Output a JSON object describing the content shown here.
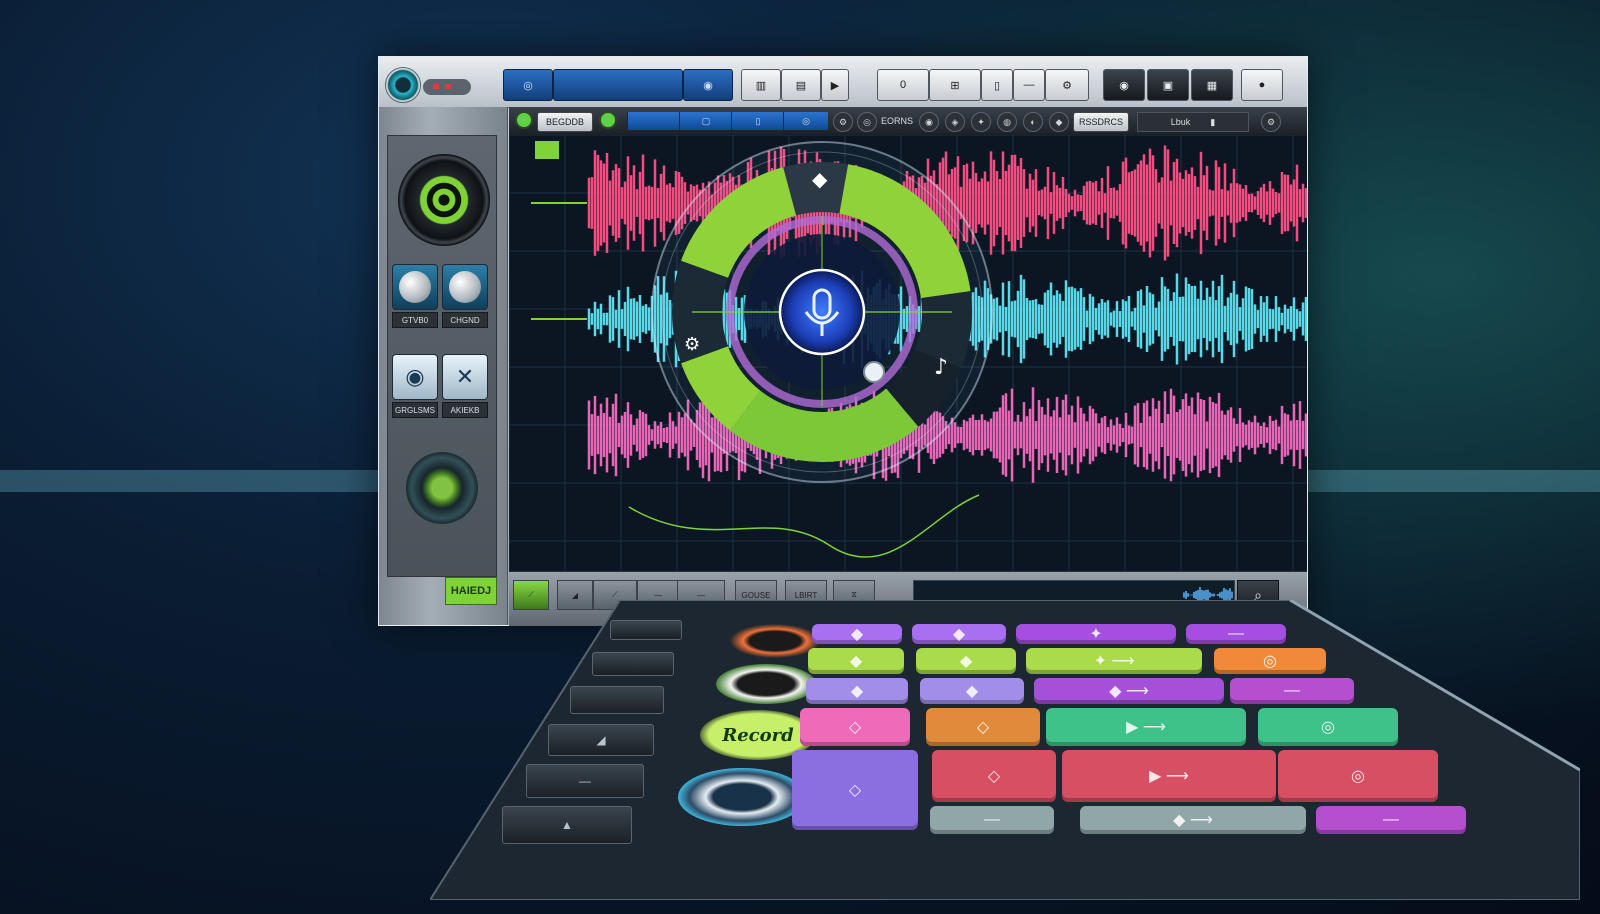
{
  "colors": {
    "accent_green": "#7fd337",
    "accent_blue": "#2a74d0",
    "wave_pink": "#ff4f86",
    "wave_cyan": "#5fe3f2",
    "wave_magenta": "#ff6fc8"
  },
  "toolbar": {
    "icons": [
      "power-icon",
      "status-leds-icon",
      "loop-icon",
      "play-icon",
      "split-icon",
      "grid-icon",
      "mic-icon",
      "settings-icon",
      "eye-icon",
      "record-icon"
    ]
  },
  "subbar": {
    "record_label": "BEGDDB",
    "mode_label": "EORNS",
    "preset_label": "RSSDRCS",
    "level_label": "Lbuk"
  },
  "left_panel": {
    "knob1_label": "GTVB0",
    "knob2_label": "CHGND",
    "button1_label": "GRGLSMS",
    "button2_label": "AKIEKB",
    "status_label": "HAIEDJ"
  },
  "bottom_bar": {
    "btn_labels": [
      "",
      "",
      "",
      "",
      "GOUSE",
      "LBIRT",
      ""
    ],
    "search_icon": "search-icon"
  },
  "dial": {
    "center_icon": "microphone-icon"
  },
  "controller": {
    "record_label": "Record"
  }
}
